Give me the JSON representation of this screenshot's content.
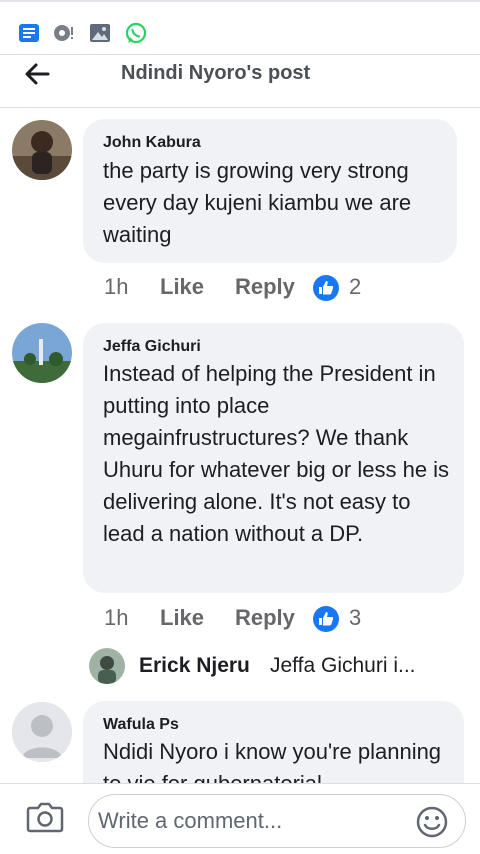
{
  "header": {
    "title": "Ndindi Nyoro's post"
  },
  "comments": [
    {
      "author": "John Kabura",
      "text": "the party is growing very strong every day kujeni kiambu we are waiting",
      "time": "1h",
      "like_label": "Like",
      "reply_label": "Reply",
      "reactions": "2"
    },
    {
      "author": "Jeffa Gichuri",
      "text": "Instead of helping the President in putting into place megainfrustructures? We thank Uhuru for whatever big or less he is delivering alone. It's not easy to lead a nation without a DP.",
      "time": "1h",
      "like_label": "Like",
      "reply_label": "Reply",
      "reactions": "3"
    },
    {
      "author": "Wafula Ps",
      "text": "Ndidi Nyoro i know you're planning to vie for gubernatorial"
    }
  ],
  "reply_preview": {
    "author": "Erick Njeru",
    "text": "Jeffa Gichuri i..."
  },
  "composer": {
    "placeholder": "Write a comment..."
  },
  "colors": {
    "like_blue": "#1877f2",
    "whatsapp_green": "#25d366",
    "muted_text": "#65676b"
  },
  "icons": [
    "news-icon",
    "podcast-icon",
    "gallery-icon",
    "whatsapp-icon",
    "back-arrow-icon",
    "thumbs-up-icon",
    "camera-icon",
    "emoji-icon"
  ]
}
